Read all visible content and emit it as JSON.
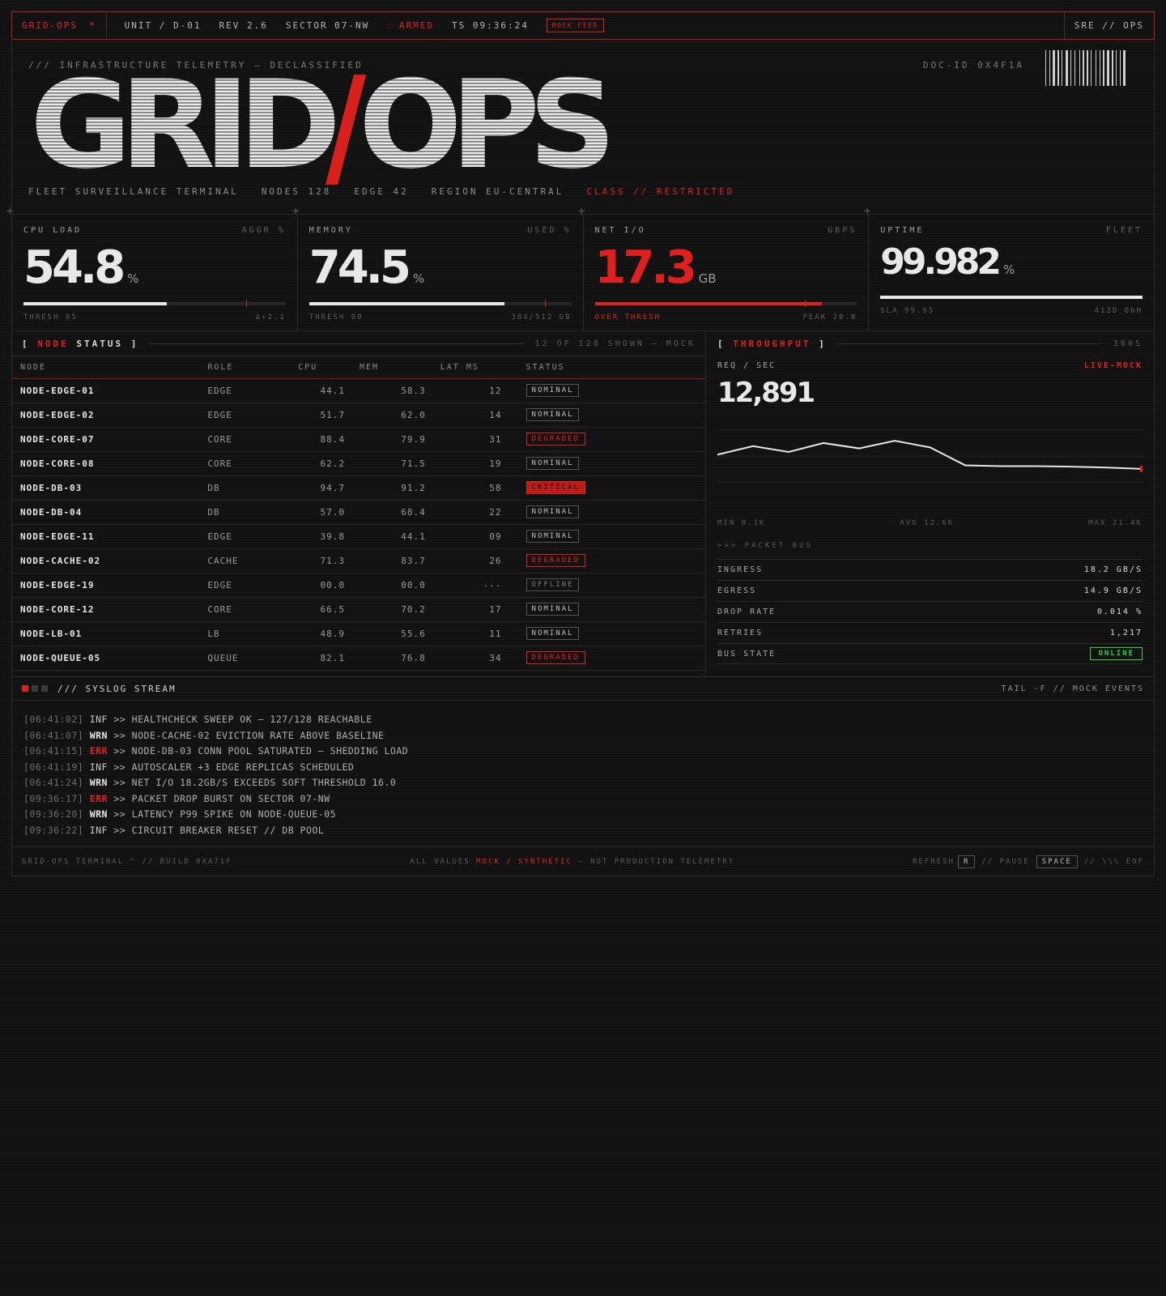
{
  "topbar": {
    "brand": "GRID-OPS",
    "brand_mark": "*",
    "unit": "UNIT / D-01",
    "rev": "REV 2.6",
    "sector": "SECTOR 07-NW",
    "armed_dot": "○",
    "armed": "ARMED",
    "timestamp": "TS 09:36:24",
    "mock_feed": "MOCK FEED",
    "right": "SRE // OPS"
  },
  "hero": {
    "kicker": "/// INFRASTRUCTURE TELEMETRY — DECLASSIFIED",
    "doc_id": "DOC-ID 0X4F1A",
    "title_left": "GRID",
    "title_slash": "/",
    "title_right": "OPS",
    "sub": {
      "terminal": "FLEET SURVEILLANCE TERMINAL",
      "nodes": "NODES 128",
      "edge": "EDGE 42",
      "region": "REGION EU-CENTRAL",
      "class": "CLASS // RESTRICTED"
    }
  },
  "metrics": [
    {
      "label": "CPU LOAD",
      "unit_label": "AGGR %",
      "value": "54.8",
      "unit": "%",
      "fill": 0.548,
      "thresh": 0.85,
      "foot_left": "THRESH 85",
      "foot_right": "Δ+2.1",
      "hot": false
    },
    {
      "label": "MEMORY",
      "unit_label": "USED %",
      "value": "74.5",
      "unit": "%",
      "fill": 0.745,
      "thresh": 0.9,
      "foot_left": "THRESH 90",
      "foot_right": "384/512 GB",
      "hot": false
    },
    {
      "label": "NET I/O",
      "unit_label": "GBPS",
      "value": "17.3",
      "unit": "GB",
      "fill": 0.865,
      "thresh": 0.8,
      "foot_left": "OVER THRESH",
      "foot_right": "PEAK 20.0",
      "hot": true
    },
    {
      "label": "UPTIME",
      "unit_label": "FLEET",
      "value": "99.982",
      "unit": "%",
      "fill": 0.99982,
      "thresh": null,
      "foot_left": "SLA 99.95",
      "foot_right": "412D 06H",
      "hot": false
    }
  ],
  "nodes": {
    "title_prefix": "[ ",
    "title_red": "NODE",
    "title_rest": " STATUS ]",
    "meta": "12 OF 128 SHOWN — MOCK",
    "columns": [
      "NODE",
      "ROLE",
      "CPU",
      "MEM",
      "LAT MS",
      "STATUS"
    ],
    "rows": [
      {
        "node": "NODE-EDGE-01",
        "role": "EDGE",
        "cpu": "44.1",
        "mem": "58.3",
        "lat": "12",
        "status": "NOMINAL"
      },
      {
        "node": "NODE-EDGE-02",
        "role": "EDGE",
        "cpu": "51.7",
        "mem": "62.0",
        "lat": "14",
        "status": "NOMINAL"
      },
      {
        "node": "NODE-CORE-07",
        "role": "CORE",
        "cpu": "88.4",
        "mem": "79.9",
        "lat": "31",
        "status": "DEGRADED"
      },
      {
        "node": "NODE-CORE-08",
        "role": "CORE",
        "cpu": "62.2",
        "mem": "71.5",
        "lat": "19",
        "status": "NOMINAL"
      },
      {
        "node": "NODE-DB-03",
        "role": "DB",
        "cpu": "94.7",
        "mem": "91.2",
        "lat": "58",
        "status": "CRITICAL"
      },
      {
        "node": "NODE-DB-04",
        "role": "DB",
        "cpu": "57.0",
        "mem": "68.4",
        "lat": "22",
        "status": "NOMINAL"
      },
      {
        "node": "NODE-EDGE-11",
        "role": "EDGE",
        "cpu": "39.8",
        "mem": "44.1",
        "lat": "09",
        "status": "NOMINAL"
      },
      {
        "node": "NODE-CACHE-02",
        "role": "CACHE",
        "cpu": "71.3",
        "mem": "83.7",
        "lat": "26",
        "status": "DEGRADED"
      },
      {
        "node": "NODE-EDGE-19",
        "role": "EDGE",
        "cpu": "00.0",
        "mem": "00.0",
        "lat": "---",
        "status": "OFFLINE"
      },
      {
        "node": "NODE-CORE-12",
        "role": "CORE",
        "cpu": "66.5",
        "mem": "70.2",
        "lat": "17",
        "status": "NOMINAL"
      },
      {
        "node": "NODE-LB-01",
        "role": "LB",
        "cpu": "48.9",
        "mem": "55.6",
        "lat": "11",
        "status": "NOMINAL"
      },
      {
        "node": "NODE-QUEUE-05",
        "role": "QUEUE",
        "cpu": "82.1",
        "mem": "76.8",
        "lat": "34",
        "status": "DEGRADED"
      }
    ]
  },
  "throughput": {
    "title_prefix": "[ ",
    "title_red": "THROUGHPUT",
    "title_suffix": " ]",
    "window": "300S",
    "label": "REQ / SEC",
    "live": "LIVE-MOCK",
    "value": "12,891",
    "spark": [
      15.5,
      17.4,
      16.1,
      18.1,
      16.9,
      18.6,
      17.1,
      13.1,
      12.9,
      12.9,
      12.8,
      12.6,
      12.3
    ],
    "spark_range": [
      5,
      25
    ],
    "min": "MIN 8.1K",
    "avg": "AVG 12.6K",
    "max": "MAX 21.4K",
    "bus_title": ">>> PACKET BUS",
    "kv": [
      {
        "k": "INGRESS",
        "v": "18.2 GB/S"
      },
      {
        "k": "EGRESS",
        "v": "14.9 GB/S"
      },
      {
        "k": "DROP RATE",
        "v": "0.014 %"
      },
      {
        "k": "RETRIES",
        "v": "1,217"
      },
      {
        "k": "BUS STATE",
        "v": "ONLINE"
      }
    ]
  },
  "syslog": {
    "title": "/// SYSLOG STREAM",
    "meta": "TAIL -F // MOCK EVENTS",
    "lines": [
      {
        "ts": "[06:41:02]",
        "lv": "INF",
        "msg": ">> HEALTHCHECK SWEEP OK — 127/128 REACHABLE"
      },
      {
        "ts": "[06:41:07]",
        "lv": "WRN",
        "msg": ">> NODE-CACHE-02 EVICTION RATE ABOVE BASELINE"
      },
      {
        "ts": "[06:41:15]",
        "lv": "ERR",
        "msg": ">> NODE-DB-03 CONN POOL SATURATED — SHEDDING LOAD"
      },
      {
        "ts": "[06:41:19]",
        "lv": "INF",
        "msg": ">> AUTOSCALER +3 EDGE REPLICAS SCHEDULED"
      },
      {
        "ts": "[06:41:24]",
        "lv": "WRN",
        "msg": ">> NET I/O 18.2GB/S EXCEEDS SOFT THRESHOLD 16.0"
      },
      {
        "ts": "[09:36:17]",
        "lv": "ERR",
        "msg": ">> PACKET DROP BURST ON SECTOR 07-NW"
      },
      {
        "ts": "[09:36:20]",
        "lv": "WRN",
        "msg": ">> LATENCY P99 SPIKE ON NODE-QUEUE-05"
      },
      {
        "ts": "[09:36:22]",
        "lv": "INF",
        "msg": ">> CIRCUIT BREAKER RESET // DB POOL"
      }
    ]
  },
  "footer": {
    "left": "GRID-OPS TERMINAL ^ // BUILD 0XA71F",
    "mid_pre": "ALL VALUES ",
    "mid_red": "MOCK / SYNTHETIC",
    "mid_post": " — NOT PRODUCTION TELEMETRY",
    "refresh": "REFRESH",
    "refresh_key": "R",
    "sep1": "// PAUSE",
    "pause_key": "SPACE",
    "end": "// \\\\\\ EOF"
  },
  "colors": {
    "accent": "#e0201e",
    "ok": "#2fd13a",
    "text": "#e8e8e8",
    "bg": "#111111"
  }
}
